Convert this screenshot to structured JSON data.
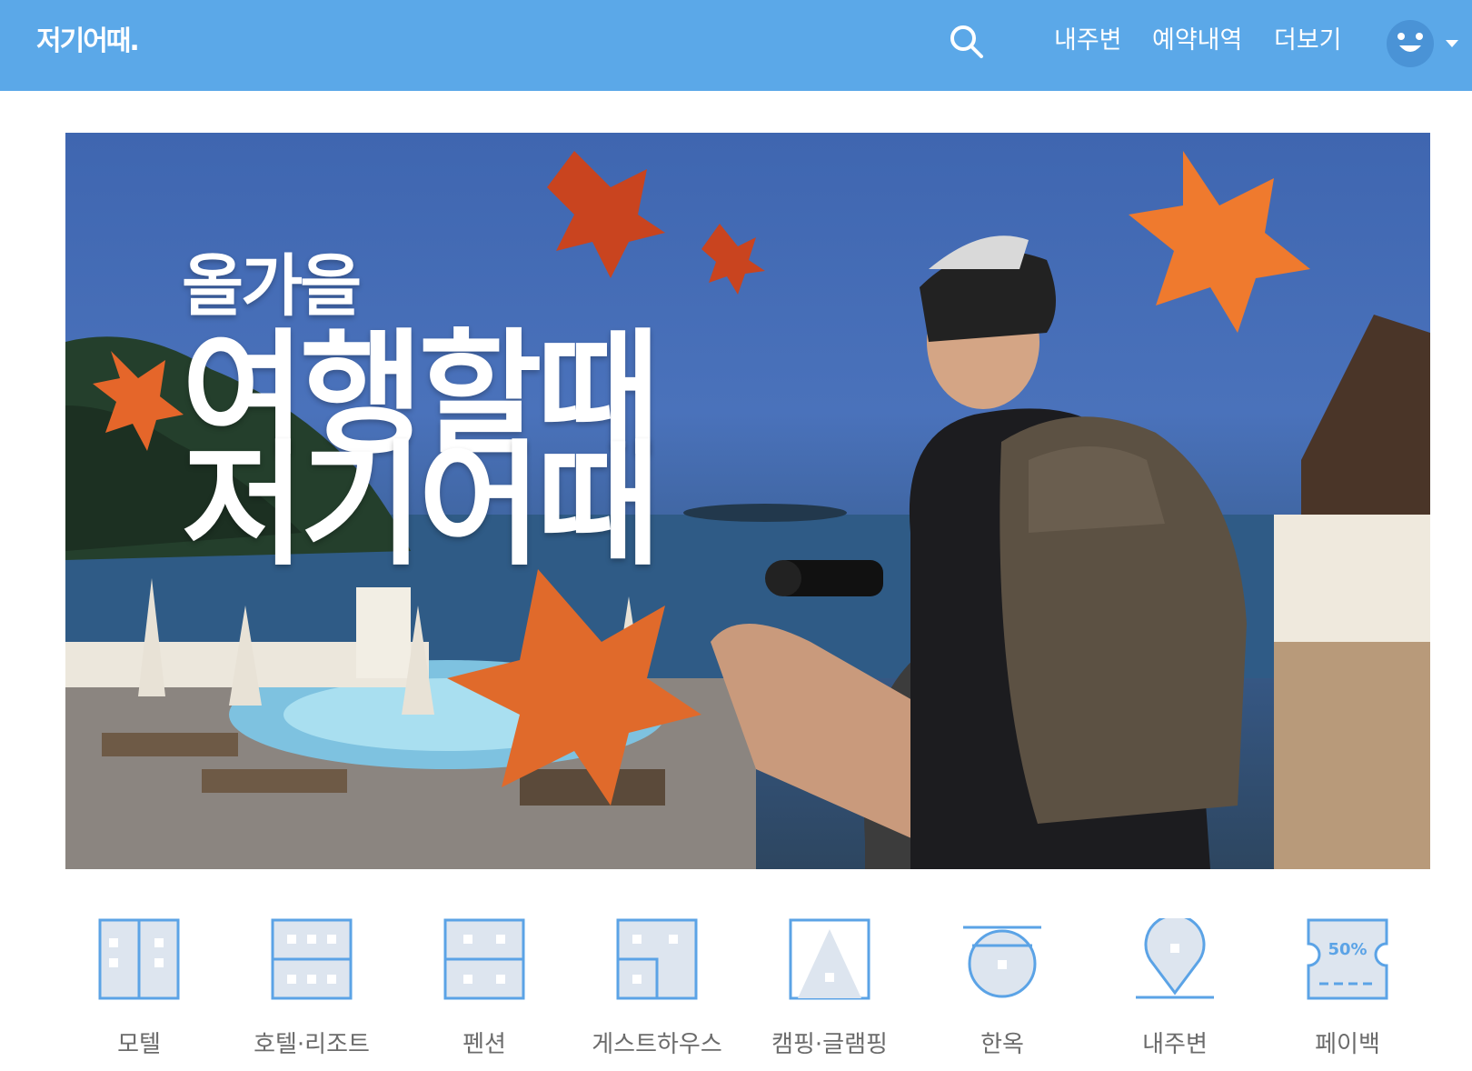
{
  "header": {
    "logo": "저기어때.",
    "nav": [
      "내주변",
      "예약내역",
      "더보기"
    ],
    "search_icon": "search-icon",
    "avatar_icon": "smiley-avatar-icon",
    "bg_color": "#5ba8e8"
  },
  "banner": {
    "line1": "올가을",
    "line2": "여행할때",
    "line3": "저기어때"
  },
  "categories": [
    {
      "label": "모텔",
      "icon": "motel-icon"
    },
    {
      "label": "호텔·리조트",
      "icon": "hotel-resort-icon"
    },
    {
      "label": "펜션",
      "icon": "pension-icon"
    },
    {
      "label": "게스트하우스",
      "icon": "guesthouse-icon"
    },
    {
      "label": "캠핑·글램핑",
      "icon": "camping-glamping-icon"
    },
    {
      "label": "한옥",
      "icon": "hanok-icon"
    },
    {
      "label": "내주변",
      "icon": "nearby-pin-icon"
    },
    {
      "label": "페이백",
      "icon": "payback-coupon-icon",
      "badge": "50%"
    }
  ],
  "colors": {
    "accent": "#5ba8e8",
    "icon_stroke": "#5ba3e6",
    "icon_fill": "#dde5ef",
    "label": "#6b6b6b"
  }
}
